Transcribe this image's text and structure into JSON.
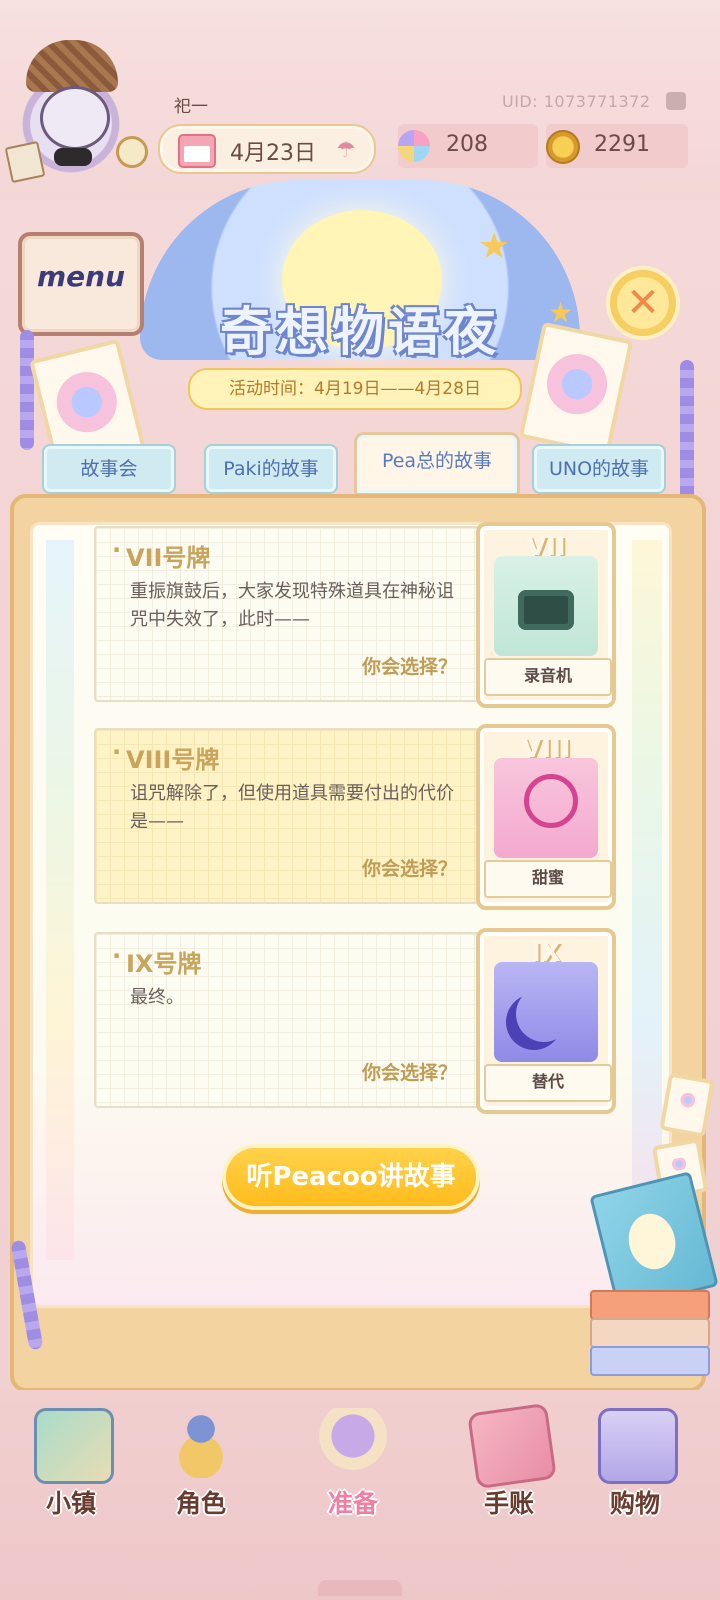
{
  "header": {
    "player_name": "祀一",
    "uid": "UID: 1073771372",
    "date": "4月23日",
    "gems": "208",
    "coins": "2291"
  },
  "event": {
    "title": "奇想物语夜",
    "time": "活动时间：4月19日——4月28日",
    "menu_sign": "menu"
  },
  "tabs": [
    {
      "label": "故事会"
    },
    {
      "label": "Paki的故事"
    },
    {
      "label": "Pea总的故事",
      "active": true
    },
    {
      "label": "UNO的故事"
    }
  ],
  "stories": [
    {
      "title": "VII号牌",
      "desc": "重振旗鼓后，大家发现特殊道具在神秘诅咒中失效了，此时——",
      "choose": "你会选择？",
      "card_numeral": "VII",
      "card_name": "录音机"
    },
    {
      "title": "VIII号牌",
      "desc": "诅咒解除了，但使用道具需要付出的代价是——",
      "choose": "你会选择？",
      "card_numeral": "VIII",
      "card_name": "甜蜜"
    },
    {
      "title": "IX号牌",
      "desc": "最终。",
      "choose": "你会选择？",
      "card_numeral": "IX",
      "card_name": "替代"
    }
  ],
  "listen_button": "听Peacoo讲故事",
  "bottom_nav": [
    {
      "label": "小镇"
    },
    {
      "label": "角色"
    },
    {
      "label": "准备",
      "active": true
    },
    {
      "label": "手账"
    },
    {
      "label": "购物"
    }
  ],
  "colors": {
    "accent_gold": "#c9a45b",
    "tab_blue": "#4f6fb0",
    "button_yellow": "#ffbc1d"
  }
}
